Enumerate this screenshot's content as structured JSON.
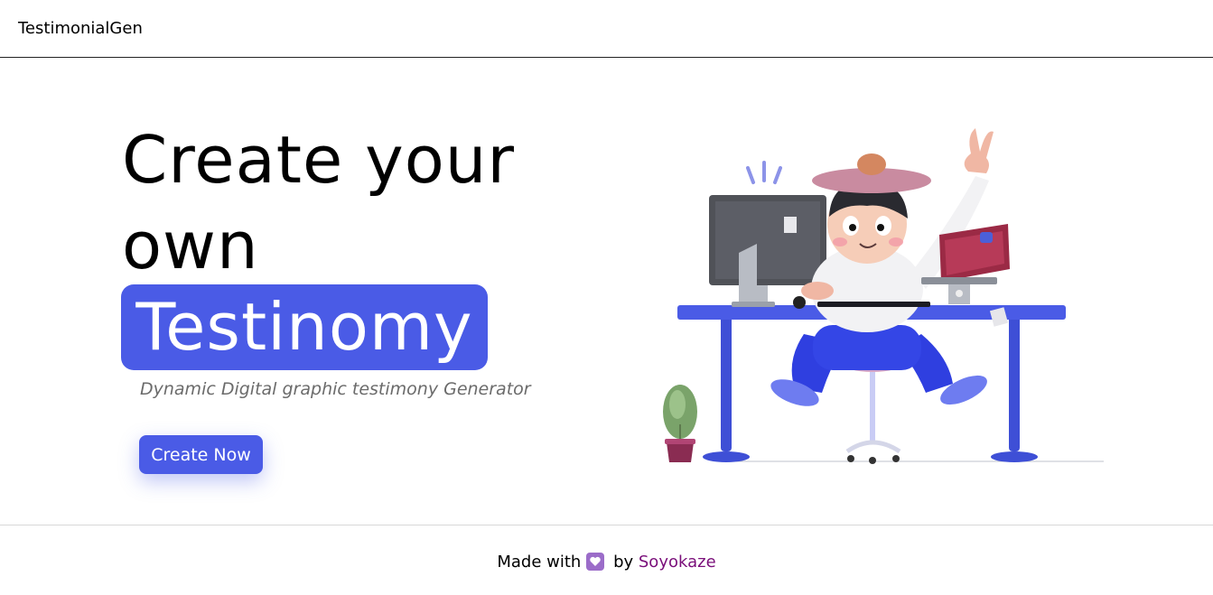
{
  "navbar": {
    "brand": "TestimonialGen"
  },
  "hero": {
    "title_line1": "Create your",
    "title_line2": "own",
    "highlight": "Testinomy",
    "subtitle": "Dynamic Digital graphic testimony Generator",
    "cta_label": "Create Now",
    "accent_color": "#4a5be6"
  },
  "illustration": {
    "icon": "person-at-desk-illustration"
  },
  "footer": {
    "made_with": "Made with",
    "heart_icon": "heart-icon",
    "by": "by",
    "author": "Soyokaze",
    "author_color": "#7a0f7a"
  }
}
